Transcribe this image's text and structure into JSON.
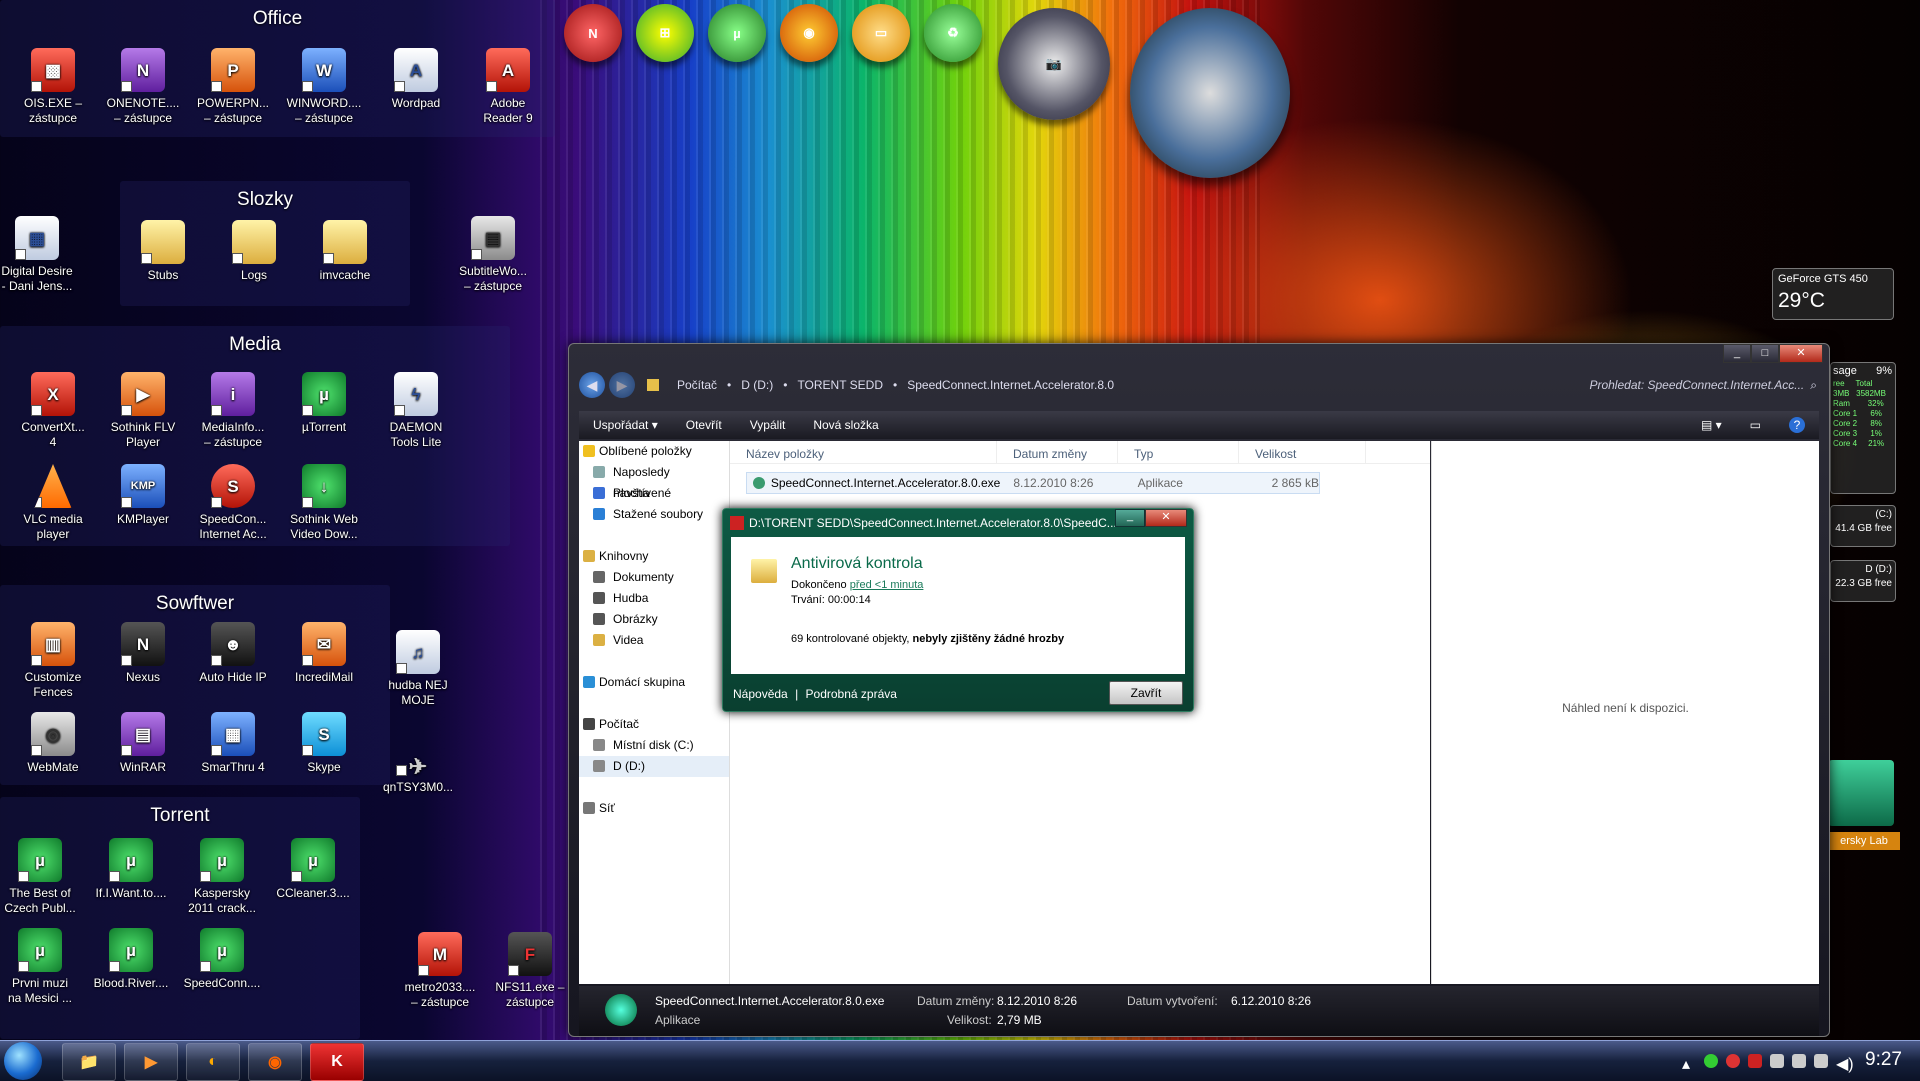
{
  "groups": {
    "office": {
      "title": "Office",
      "icons": [
        {
          "label": "OIS.EXE –\nzástupce",
          "glyph": "▩"
        },
        {
          "label": "ONENOTE....\n– zástupce",
          "glyph": "N"
        },
        {
          "label": "POWERPN...\n– zástupce",
          "glyph": "P"
        },
        {
          "label": "WINWORD....\n– zástupce",
          "glyph": "W"
        },
        {
          "label": "Wordpad",
          "glyph": "A"
        },
        {
          "label": "Adobe\nReader 9",
          "glyph": "A"
        }
      ]
    },
    "slozky": {
      "title": "Slozky",
      "icons": [
        {
          "label": "Stubs"
        },
        {
          "label": "Logs"
        },
        {
          "label": "imvcache"
        }
      ]
    },
    "media": {
      "title": "Media",
      "icons": [
        {
          "label": "ConvertXt...\n4",
          "glyph": "X"
        },
        {
          "label": "Sothink FLV\nPlayer",
          "glyph": "▶"
        },
        {
          "label": "MediaInfo...\n– zástupce",
          "glyph": "i"
        },
        {
          "label": "µTorrent",
          "glyph": "µ"
        },
        {
          "label": "DAEMON\nTools Lite",
          "glyph": "ϟ"
        },
        {
          "label": "VLC media\nplayer",
          "glyph": ""
        },
        {
          "label": "KMPlayer",
          "glyph": "KMP"
        },
        {
          "label": "SpeedCon...\nInternet Ac...",
          "glyph": "S"
        },
        {
          "label": "Sothink Web\nVideo Dow...",
          "glyph": "↓"
        }
      ]
    },
    "sowftwer": {
      "title": "Sowftwer",
      "icons": [
        {
          "label": "Customize\nFences",
          "glyph": "▥"
        },
        {
          "label": "Nexus",
          "glyph": "N"
        },
        {
          "label": "Auto Hide IP",
          "glyph": "☻"
        },
        {
          "label": "IncrediMail",
          "glyph": "✉"
        },
        {
          "label": "WebMate",
          "glyph": "◎"
        },
        {
          "label": "WinRAR",
          "glyph": "▤"
        },
        {
          "label": "SmarThru 4",
          "glyph": "▦"
        },
        {
          "label": "Skype",
          "glyph": "S"
        }
      ]
    },
    "torrent": {
      "title": "Torrent",
      "icons": [
        {
          "label": "The Best of\nCzech Publ...",
          "glyph": "µ"
        },
        {
          "label": "If.I.Want.to....",
          "glyph": "µ"
        },
        {
          "label": "Kaspersky\n2011  crack...",
          "glyph": "µ"
        },
        {
          "label": "CCleaner.3....",
          "glyph": "µ"
        },
        {
          "label": "Prvni muzi\nna Mesici ...",
          "glyph": "µ"
        },
        {
          "label": "Blood.River....",
          "glyph": "µ"
        },
        {
          "label": "SpeedConn....",
          "glyph": "µ"
        }
      ]
    }
  },
  "loose_icons": [
    {
      "label": "Digital Desire\n- Dani Jens...",
      "glyph": "▦"
    },
    {
      "label": "SubtitleWo...\n– zástupce",
      "glyph": "▤"
    },
    {
      "label": "hudba NEJ\nMOJE",
      "glyph": "♫"
    },
    {
      "label": "qnTSY3M0...",
      "glyph": "✈"
    },
    {
      "label": "metro2033....\n– zástupce",
      "glyph": "M"
    },
    {
      "label": "NFS11.exe –\nzástupce",
      "glyph": "F"
    }
  ],
  "dock": [
    "Nexus",
    "Windows",
    "uTorrent",
    "Firefox",
    "Drive",
    "Recycle"
  ],
  "gadgets": {
    "gpu_name": "GeForce GTS 450",
    "gpu_temp": "29°C",
    "cpu_title": "sage",
    "cpu_pct": "9%",
    "cpu_lines": [
      "ree     Total",
      "3MB   3582MB",
      "Ram        32%",
      "Core 1      6%",
      "Core 2      8%",
      "Core 3      1%",
      "Core 4     21%"
    ],
    "drive_c": "(C:)\n41.4 GB free",
    "drive_d": "D (D:)\n22.3 GB free",
    "kaspersky": "ersky Lab"
  },
  "explorer": {
    "breadcrumbs": [
      "Počítač",
      "D (D:)",
      "TORENT SEDD",
      "SpeedConnect.Internet.Accelerator.8.0"
    ],
    "search_placeholder": "Prohledat: SpeedConnect.Internet.Acc...",
    "toolbar": [
      "Uspořádat ▾",
      "Otevřít",
      "Vypálit",
      "Nová složka"
    ],
    "nav": [
      {
        "label": "Oblíbené položky",
        "top": true,
        "color": "#f0c020"
      },
      {
        "label": "Naposledy navštívené",
        "top": false,
        "color": "#8aa"
      },
      {
        "label": "Plocha",
        "top": false,
        "color": "#3a6ed6"
      },
      {
        "label": "Stažené soubory",
        "top": false,
        "color": "#2a7fd6"
      },
      {
        "label": "",
        "top": false,
        "color": "transparent"
      },
      {
        "label": "Knihovny",
        "top": true,
        "color": "#dbb043"
      },
      {
        "label": "Dokumenty",
        "top": false,
        "color": "#666"
      },
      {
        "label": "Hudba",
        "top": false,
        "color": "#555"
      },
      {
        "label": "Obrázky",
        "top": false,
        "color": "#555"
      },
      {
        "label": "Videa",
        "top": false,
        "color": "#dbb043"
      },
      {
        "label": "",
        "top": false,
        "color": "transparent"
      },
      {
        "label": "Domácí skupina",
        "top": true,
        "color": "#2a8fd6"
      },
      {
        "label": "",
        "top": false,
        "color": "transparent"
      },
      {
        "label": "Počítač",
        "top": true,
        "color": "#444"
      },
      {
        "label": "Místní disk (C:)",
        "top": false,
        "color": "#888"
      },
      {
        "label": "D (D:)",
        "top": false,
        "color": "#888"
      },
      {
        "label": "",
        "top": false,
        "color": "transparent"
      },
      {
        "label": "Síť",
        "top": true,
        "color": "#777"
      }
    ],
    "columns": [
      "Název položky",
      "Datum změny",
      "Typ",
      "Velikost"
    ],
    "file": {
      "name": "SpeedConnect.Internet.Accelerator.8.0.exe",
      "date": "8.12.2010 8:26",
      "type": "Aplikace",
      "size": "2 865 kB"
    },
    "preview_text": "Náhled není k dispozici.",
    "details": {
      "name": "SpeedConnect.Internet.Accelerator.8.0.exe",
      "type": "Aplikace",
      "modified_label": "Datum změny:",
      "modified": "8.12.2010 8:26",
      "size_label": "Velikost:",
      "size": "2,79 MB",
      "created_label": "Datum vytvoření:",
      "created": "6.12.2010 8:26"
    }
  },
  "dialog": {
    "title": "D:\\TORENT SEDD\\SpeedConnect.Internet.Accelerator.8.0\\SpeedC...",
    "heading": "Antivirová kontrola",
    "status_label": "Dokončeno",
    "status_link": "před <1 minuta",
    "duration": "Trvání: 00:00:14",
    "result_prefix": "69 kontrolované objekty, ",
    "result_bold": "nebyly zjištěny žádné hrozby",
    "help": "Nápověda",
    "report": "Podrobná zpráva",
    "close": "Zavřít"
  },
  "taskbar": {
    "clock": "9:27",
    "apps": [
      "Explorer",
      "Media",
      "Player",
      "Firefox",
      "Kaspersky"
    ]
  }
}
